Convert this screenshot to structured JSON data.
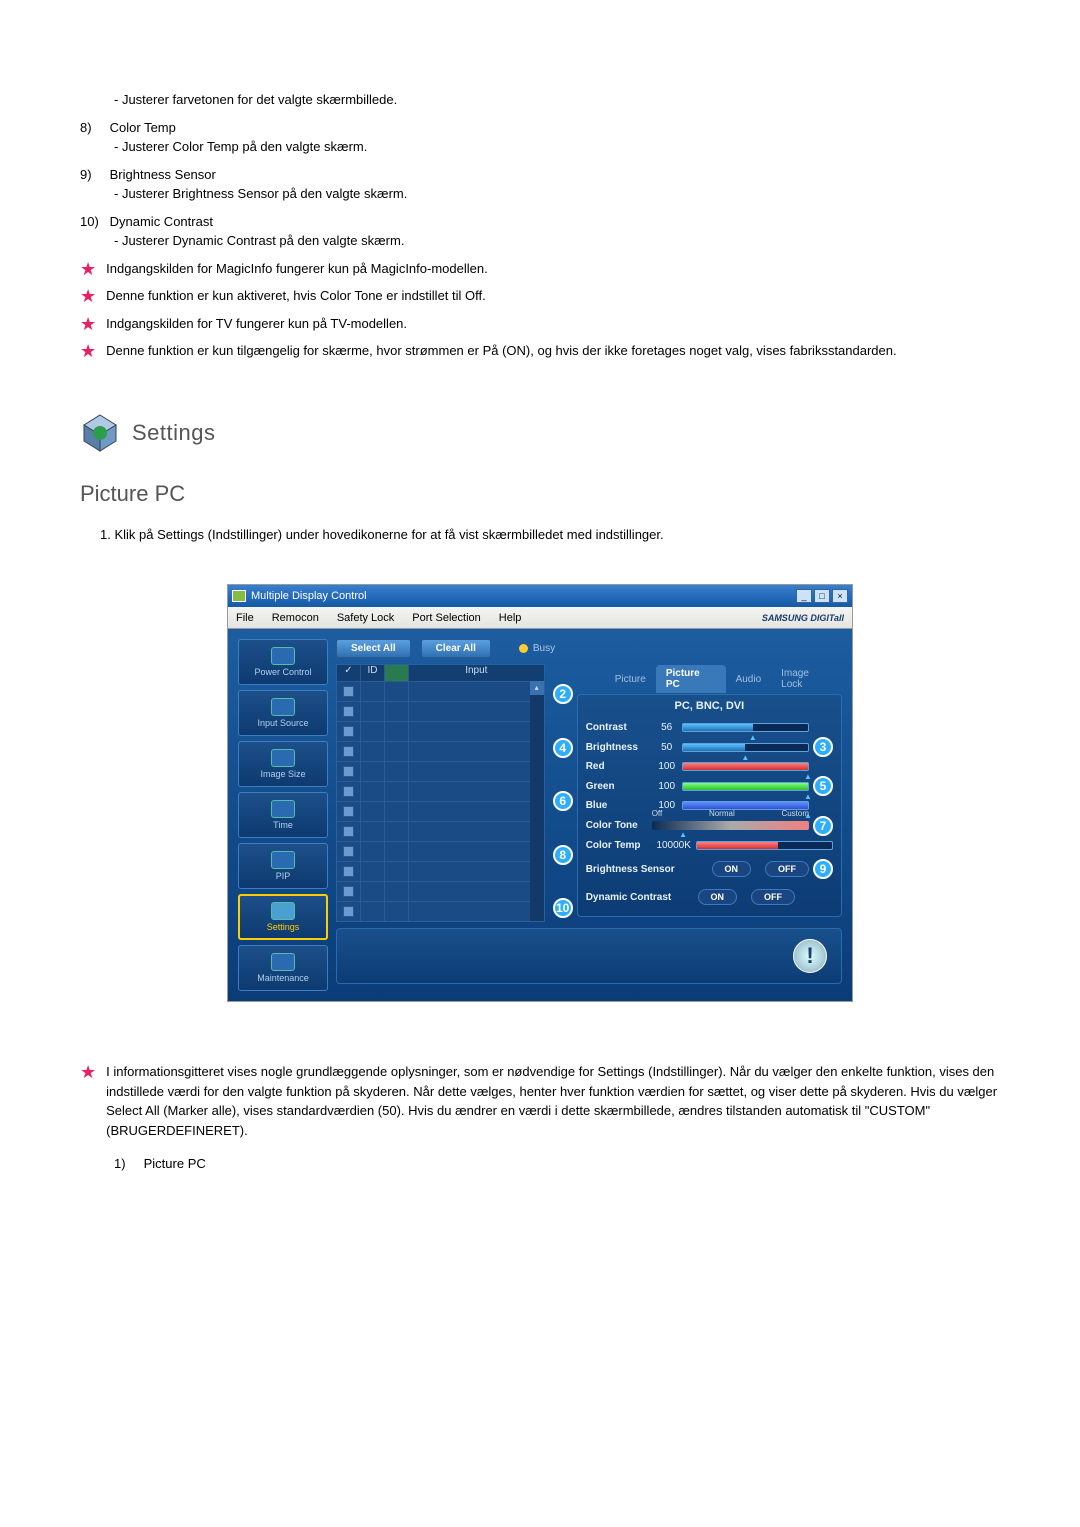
{
  "pre_list": {
    "i7_desc": "- Justerer farvetonen for det valgte skærmbillede."
  },
  "list": [
    {
      "n": "8)",
      "t": "Color Temp",
      "d": "- Justerer Color Temp på den valgte skærm."
    },
    {
      "n": "9)",
      "t": "Brightness Sensor",
      "d": "- Justerer Brightness Sensor på den valgte skærm."
    },
    {
      "n": "10)",
      "t": "Dynamic Contrast",
      "d": "- Justerer Dynamic Contrast på den valgte skærm."
    }
  ],
  "stars": [
    "Indgangskilden for MagicInfo fungerer kun på MagicInfo-modellen.",
    "Denne funktion er kun aktiveret, hvis Color Tone er indstillet til Off.",
    "Indgangskilden for TV fungerer kun på TV-modellen.",
    "Denne funktion er kun tilgængelig for skærme, hvor strømmen er På (ON), og hvis der ikke foretages noget valg, vises fabriksstandarden."
  ],
  "settings_label": "Settings",
  "section_title": "Picture PC",
  "instruction": "1. Klik på Settings (Indstillinger) under hovedikonerne for at få vist skærmbilledet med indstillinger.",
  "bottom_star": "I informationsgitteret vises nogle grundlæggende oplysninger, som er nødvendige for Settings (Indstillinger). Når du vælger den enkelte funktion, vises den indstillede værdi for den valgte funktion på skyderen. Når dette vælges, henter hver funktion værdien for sættet, og viser dette på skyderen. Hvis du vælger Select All (Marker alle), vises standardværdien (50). Hvis du ændrer en værdi i dette skærmbillede, ændres tilstanden automatisk til \"CUSTOM\" (BRUGERDEFINERET).",
  "bottom_list_1": {
    "n": "1)",
    "t": "Picture PC"
  },
  "app": {
    "title": "Multiple Display Control",
    "menu": [
      "File",
      "Remocon",
      "Safety Lock",
      "Port Selection",
      "Help"
    ],
    "brand": "SAMSUNG DIGITall",
    "btn_select_all": "Select All",
    "btn_clear_all": "Clear All",
    "busy": "Busy",
    "nav": [
      "Power Control",
      "Input Source",
      "Image Size",
      "Time",
      "PIP",
      "Settings",
      "Maintenance"
    ],
    "grid_cols": {
      "check": "✓",
      "id": "ID",
      "input": "Input"
    },
    "tabs": [
      "Picture",
      "Picture PC",
      "Audio",
      "Image Lock"
    ],
    "panel_title": "PC, BNC, DVI",
    "sliders": [
      {
        "label": "Contrast",
        "val": "56",
        "fill": 56,
        "color": "blue"
      },
      {
        "label": "Brightness",
        "val": "50",
        "fill": 50,
        "color": "blue"
      },
      {
        "label": "Red",
        "val": "100",
        "fill": 100,
        "color": "red"
      },
      {
        "label": "Green",
        "val": "100",
        "fill": 100,
        "color": "green"
      },
      {
        "label": "Blue",
        "val": "100",
        "fill": 100,
        "color": "bluev"
      }
    ],
    "color_tone": {
      "label": "Color Tone",
      "opts": [
        "Off",
        "Normal",
        "Custom"
      ]
    },
    "color_temp": {
      "label": "Color Temp",
      "val": "10000K"
    },
    "toggles": [
      {
        "label": "Brightness Sensor",
        "on": "ON",
        "off": "OFF"
      },
      {
        "label": "Dynamic Contrast",
        "on": "ON",
        "off": "OFF"
      }
    ],
    "bubbles": {
      "2": "2",
      "3": "3",
      "4": "4",
      "5": "5",
      "6": "6",
      "7": "7",
      "8": "8",
      "9": "9",
      "10": "10"
    }
  }
}
